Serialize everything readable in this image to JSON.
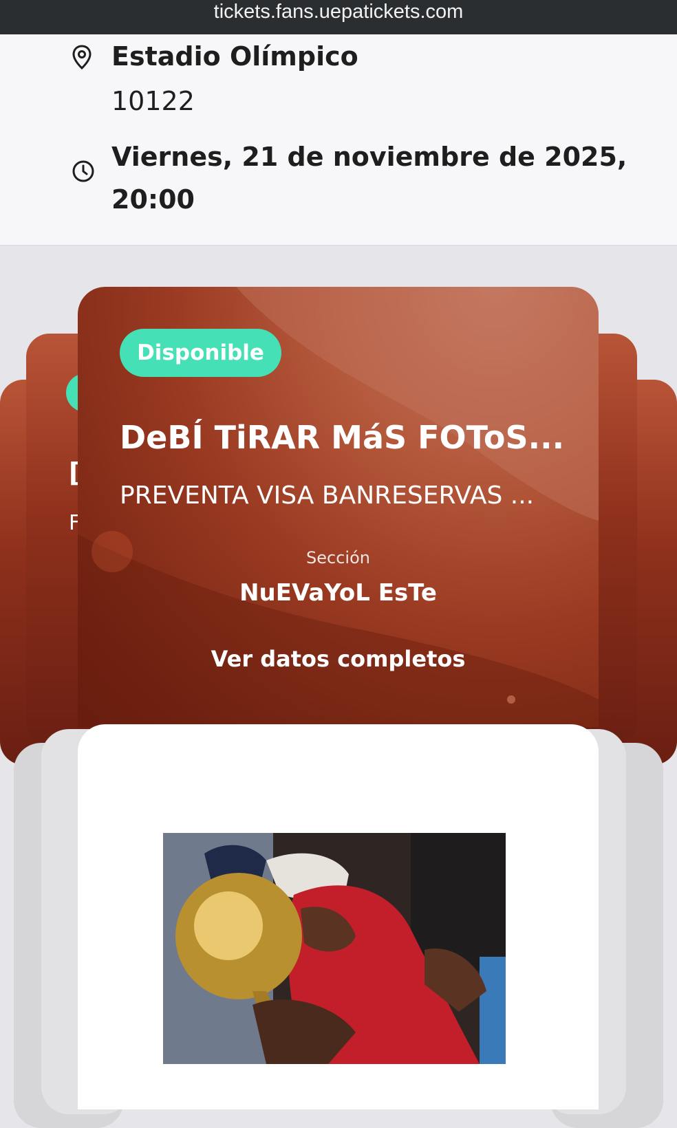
{
  "browser": {
    "url": "tickets.fans.uepatickets.com"
  },
  "event_info": {
    "venue_name": "Estadio Olímpico",
    "venue_zip": "10122",
    "date_line": "Viernes, 21 de noviembre de 2025, 20:00",
    "location_icon": "location-pin-icon",
    "time_icon": "clock-icon"
  },
  "ticket": {
    "status": "Disponible",
    "status_color": "#45e0b6",
    "title": "DeBÍ TiRAR MáS FOToS...",
    "subtitle": "PREVENTA VISA BANRESERVAS ...",
    "section_label": "Sección",
    "section_value": "NuEVaYoL EsTe",
    "details_link": "Ver datos completos",
    "card_color": "#9a3a22"
  },
  "code_image": {
    "description_icon": "ticket-photo"
  }
}
